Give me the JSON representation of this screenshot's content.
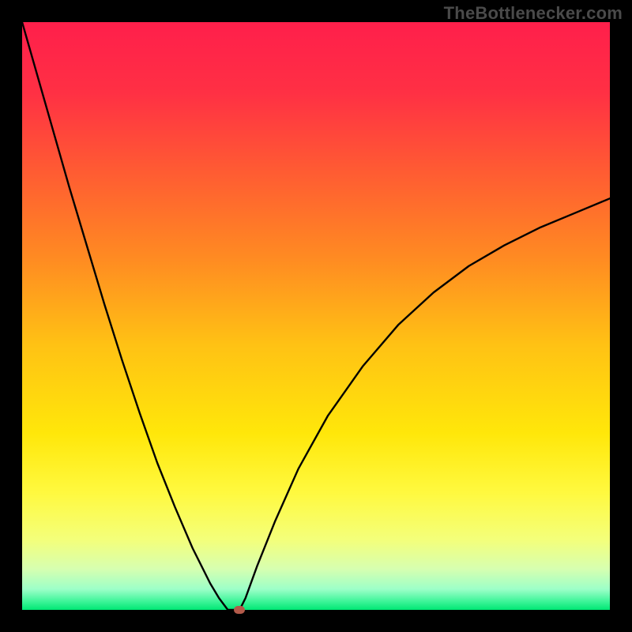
{
  "watermark": "TheBottlenecker.com",
  "colors": {
    "frame": "#000000",
    "curve": "#000000",
    "marker": "#b35a4a",
    "gradient_stops": [
      {
        "offset": 0.0,
        "color": "#ff1f4b"
      },
      {
        "offset": 0.12,
        "color": "#ff3044"
      },
      {
        "offset": 0.25,
        "color": "#ff5a33"
      },
      {
        "offset": 0.4,
        "color": "#ff8a22"
      },
      {
        "offset": 0.55,
        "color": "#ffc214"
      },
      {
        "offset": 0.7,
        "color": "#ffe70a"
      },
      {
        "offset": 0.8,
        "color": "#fff93f"
      },
      {
        "offset": 0.88,
        "color": "#f4ff7a"
      },
      {
        "offset": 0.93,
        "color": "#d7ffb0"
      },
      {
        "offset": 0.965,
        "color": "#9cffc8"
      },
      {
        "offset": 0.985,
        "color": "#40f59a"
      },
      {
        "offset": 1.0,
        "color": "#00e774"
      }
    ]
  },
  "chart_data": {
    "type": "line",
    "title": "",
    "xlabel": "",
    "ylabel": "",
    "xlim": [
      0,
      100
    ],
    "ylim": [
      0,
      100
    ],
    "grid": false,
    "legend": false,
    "x": [
      0,
      2,
      5,
      8,
      11,
      14,
      17,
      20,
      23,
      26,
      29,
      32,
      33.5,
      35,
      36,
      37,
      38,
      40,
      43,
      47,
      52,
      58,
      64,
      70,
      76,
      82,
      88,
      94,
      100
    ],
    "values": [
      100,
      93.0,
      82.5,
      72.0,
      62.0,
      52.0,
      42.5,
      33.5,
      25.0,
      17.5,
      10.5,
      4.5,
      2.0,
      0.0,
      0.0,
      0.0,
      2.0,
      7.5,
      15.0,
      24.0,
      33.0,
      41.5,
      48.5,
      54.0,
      58.5,
      62.0,
      65.0,
      67.5,
      70.0
    ],
    "optimum_x": 36.0,
    "marker": {
      "x": 37.0,
      "y": 0.0
    },
    "notes": "Gradient background runs vertically from red (top, high bottleneck) to green (bottom, low bottleneck). Black V-shaped curve with minimum near x≈36 where bottleneck ≈ 0%. Small rounded marker sits at the curve minimum."
  },
  "layout": {
    "image_size": 800,
    "plot_inset": 28,
    "plot_size": 744
  }
}
